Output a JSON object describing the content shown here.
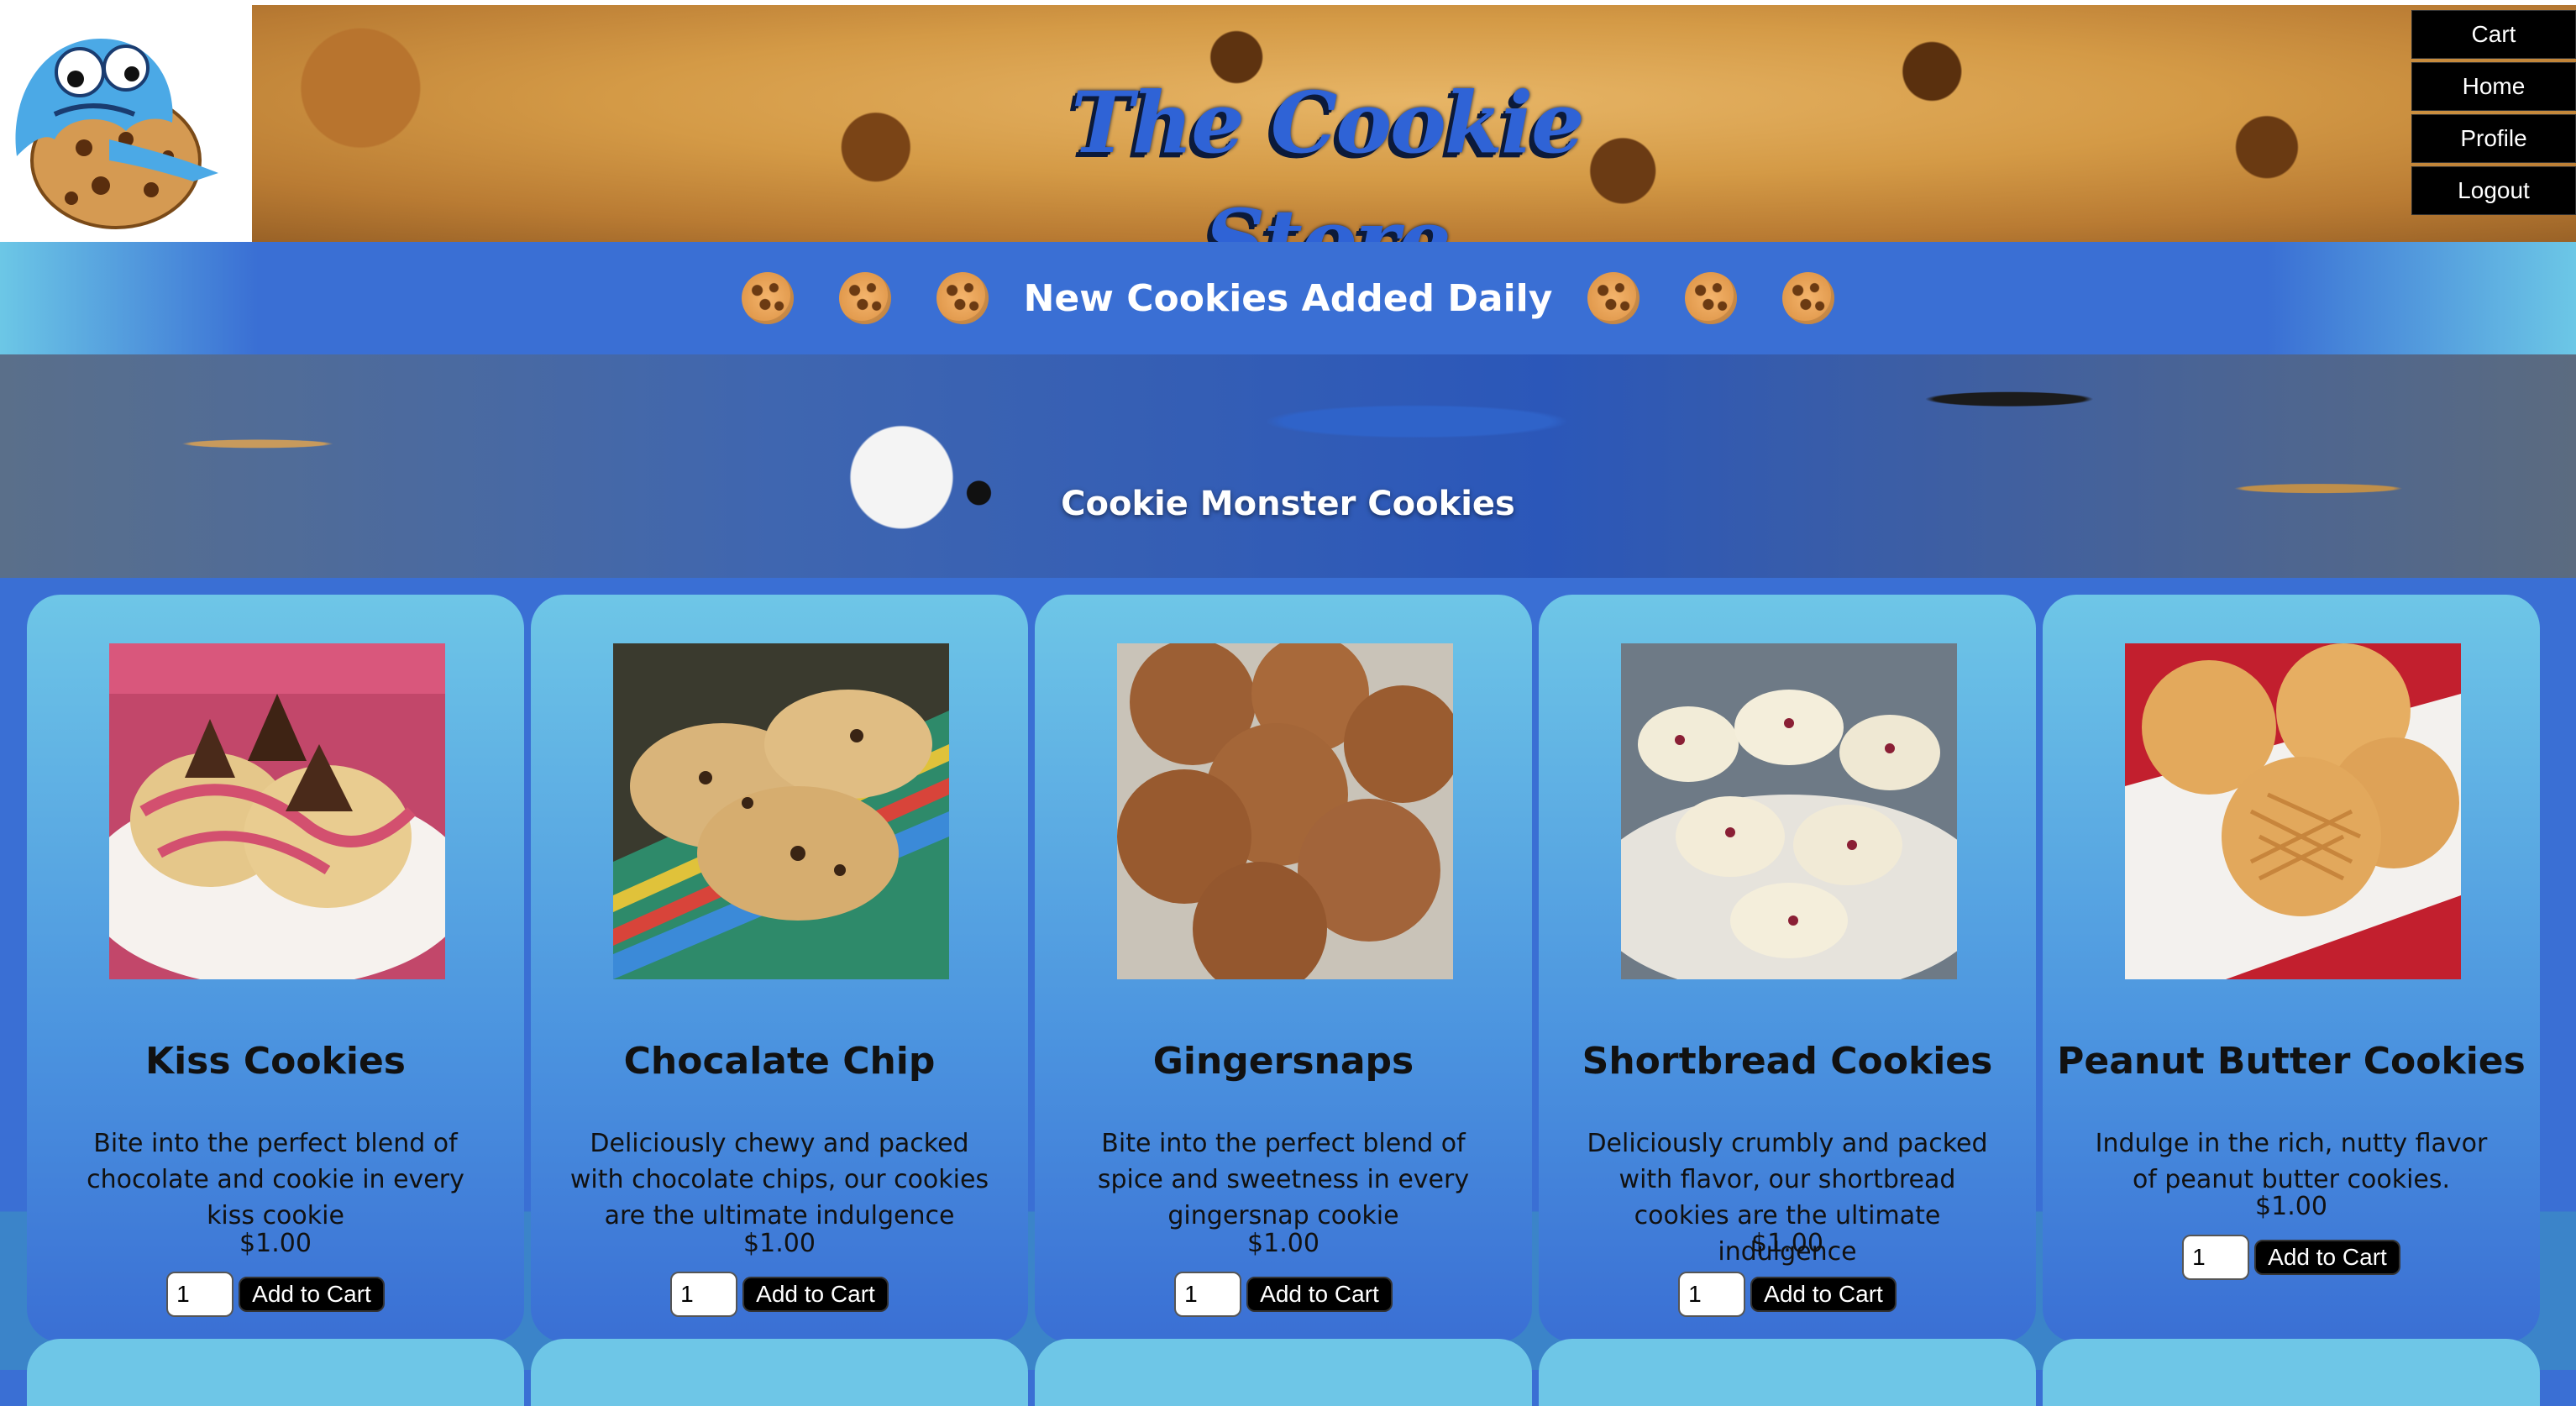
{
  "header": {
    "site_title": "The Cookie Store",
    "nav": [
      {
        "label": "Cart"
      },
      {
        "label": "Home"
      },
      {
        "label": "Profile"
      },
      {
        "label": "Logout"
      }
    ]
  },
  "banner": {
    "text": "New Cookies Added Daily",
    "icon": "cookie-icon"
  },
  "hero": {
    "title": "Cookie Monster Cookies"
  },
  "products": [
    {
      "name": "Kiss Cookies",
      "desc": "Bite into the perfect blend of chocolate and cookie in every kiss cookie",
      "price": "$1.00",
      "qty": "1",
      "button": "Add to Cart"
    },
    {
      "name": "Chocalate Chip",
      "desc": "Deliciously chewy and packed with chocolate chips, our cookies are the ultimate indulgence",
      "price": "$1.00",
      "qty": "1",
      "button": "Add to Cart"
    },
    {
      "name": "Gingersnaps",
      "desc": "Bite into the perfect blend of spice and sweetness in every gingersnap cookie",
      "price": "$1.00",
      "qty": "1",
      "button": "Add to Cart"
    },
    {
      "name": "Shortbread Cookies",
      "desc": "Deliciously crumbly and packed with flavor, our shortbread cookies are the ultimate indulgence",
      "price": "$1.00",
      "qty": "1",
      "button": "Add to Cart"
    },
    {
      "name": "Peanut Butter Cookies",
      "desc": "Indulge in the rich, nutty flavor of peanut butter cookies.",
      "price": "$1.00",
      "qty": "1",
      "button": "Add to Cart"
    }
  ],
  "colors": {
    "primary_blue": "#3a6fd4",
    "light_blue": "#6ec6e7",
    "nav_bg": "#000000"
  }
}
